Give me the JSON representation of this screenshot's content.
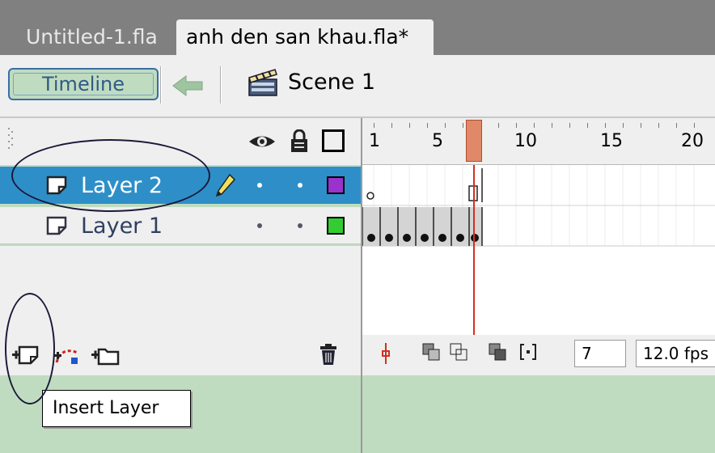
{
  "document_tabs": [
    {
      "label": "Untitled-1.fla",
      "active": false
    },
    {
      "label": "anh den san khau.fla*",
      "active": true
    }
  ],
  "toolbar": {
    "timeline_label": "Timeline",
    "back_icon": "left-arrow-icon",
    "scene_icon": "clapperboard-icon",
    "scene_label": "Scene 1"
  },
  "layer_header": {
    "icons": [
      "eye-icon",
      "lock-icon",
      "outline-icon"
    ]
  },
  "ruler": {
    "labels": [
      "1",
      "5",
      "10",
      "15",
      "20"
    ],
    "current_frame": 7
  },
  "layers": [
    {
      "name": "Layer 2",
      "selected": true,
      "editing_icon": "pencil-icon",
      "outline_color": "#9933cc"
    },
    {
      "name": "Layer 1",
      "selected": false,
      "outline_color": "#33cc33"
    }
  ],
  "layer_toolbar": {
    "icons": [
      "insert-layer-icon",
      "add-motion-guide-icon",
      "insert-layer-folder-icon",
      "delete-layer-icon"
    ]
  },
  "frame_toolbar": {
    "icons": [
      "center-frame-icon",
      "onion-skin-icon",
      "onion-skin-outlines-icon",
      "edit-multiple-frames-icon",
      "modify-onion-markers-icon"
    ],
    "current_frame": "7",
    "frame_rate": "12.0 fps"
  },
  "tooltip": {
    "text": "Insert Layer"
  },
  "colors": {
    "selection": "#2e8fc8",
    "playhead": "#d06040",
    "panel": "#efefef",
    "stage": "#c0dcc0"
  }
}
